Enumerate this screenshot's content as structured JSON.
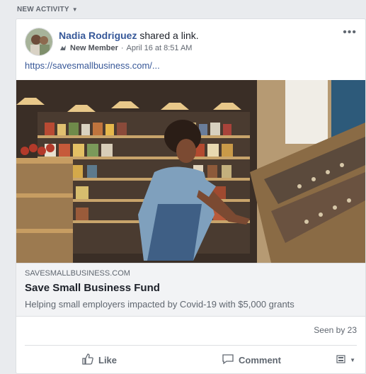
{
  "feed": {
    "section_label": "NEW ACTIVITY"
  },
  "post": {
    "author": "Nadia Rodriguez",
    "action": " shared a link.",
    "member_badge": "New Member",
    "timestamp": "April 16 at 8:51 AM",
    "meta_separator": "·",
    "link_url_text": "https://savesmallbusiness.com/...",
    "preview": {
      "domain": "SAVESMALLBUSINESS.COM",
      "title": "Save Small Business Fund",
      "description": "Helping small employers impacted by Covid-19 with $5,000 grants"
    },
    "seen_by": "Seen by 23",
    "actions": {
      "like": "Like",
      "comment": "Comment"
    }
  },
  "colors": {
    "link_blue": "#365899",
    "secondary_text": "#606770",
    "page_bg": "#e9ebee",
    "card_bg": "#ffffff",
    "preview_bg": "#f2f3f5"
  },
  "icons": [
    "caret-down-icon",
    "more-options-icon",
    "new-member-badge-icon",
    "like-thumb-icon",
    "comment-bubble-icon",
    "audience-selector-icon"
  ]
}
